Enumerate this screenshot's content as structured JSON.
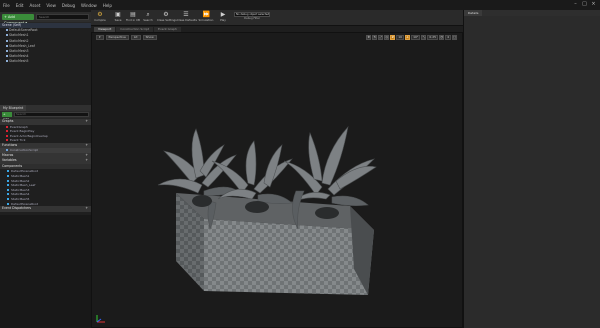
{
  "menu": {
    "items": [
      "File",
      "Edit",
      "Asset",
      "View",
      "Debug",
      "Window",
      "Help"
    ]
  },
  "window": {
    "minimize": "–",
    "maximize": "□",
    "close": "×"
  },
  "components": {
    "add_label": "+ Add Component ▾",
    "search_placeholder": "Search",
    "root": "Scene (Self)",
    "children": [
      "DefaultSceneRoot",
      "StaticMesh1",
      "StaticMesh2",
      "StaticMesh_Leaf",
      "StaticMesh3",
      "StaticMesh4",
      "StaticMesh5"
    ]
  },
  "my_blueprint": {
    "tab": "My Blueprint",
    "add_label": "+ Add New ▾",
    "search_placeholder": "Search",
    "sections": {
      "graphs": "Graphs",
      "functions": "Functions",
      "macros": "Macros",
      "variables": "Variables",
      "components": "Components",
      "event_dispatchers": "Event Dispatchers"
    },
    "graph_items": [
      "EventGraph",
      "Event BeginPlay",
      "Event ActorBeginOverlap",
      "Event Tick"
    ],
    "function_items": [
      "ConstructionScript"
    ],
    "component_items": [
      "DefaultSceneRoot",
      "StaticMesh1",
      "StaticMesh2",
      "StaticMesh_Leaf",
      "StaticMesh3",
      "StaticMesh4",
      "StaticMesh5",
      "DefaultSceneRoot"
    ]
  },
  "toolbar": {
    "buttons": [
      {
        "label": "Compile",
        "icon": "compile-icon"
      },
      {
        "label": "Save",
        "icon": "save-icon"
      },
      {
        "label": "Find in CB",
        "icon": "browse-icon"
      },
      {
        "label": "Search",
        "icon": "search-icon"
      },
      {
        "label": "Class Settings",
        "icon": "gear-icon"
      },
      {
        "label": "Class Defaults",
        "icon": "defaults-icon"
      },
      {
        "label": "Simulation",
        "icon": "simulate-icon"
      },
      {
        "label": "Play",
        "icon": "play-icon"
      }
    ],
    "debug_select": "No debug object selected ▾",
    "debug_label": "Debug Filter"
  },
  "doc_tabs": [
    "Viewport",
    "Construction Script",
    "Event Graph"
  ],
  "viewport": {
    "perspective": "Perspective",
    "lit": "Lit",
    "show": "Show",
    "snap_values": [
      "10",
      "10°",
      "0.25",
      "4"
    ]
  },
  "details": {
    "tab": "Details"
  },
  "colors": {
    "accent": "#c7831b",
    "add_green": "#3a8c3a"
  }
}
